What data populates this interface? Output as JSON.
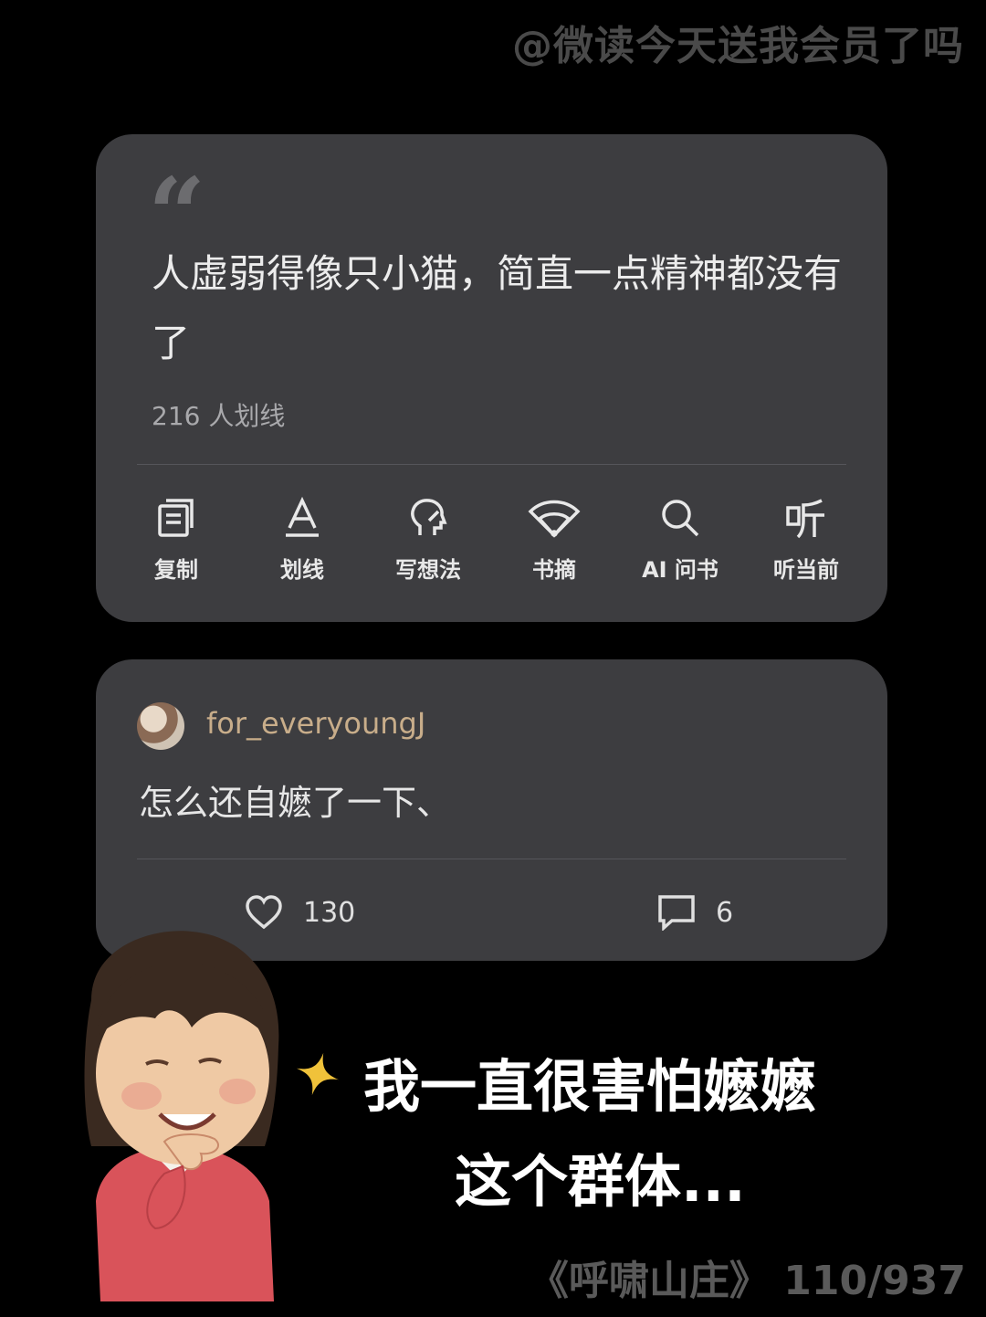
{
  "watermark": "@微读今天送我会员了吗",
  "quote": {
    "text": "人虚弱得像只小猫，简直一点精神都没有了",
    "highlight_count": "216 人划线"
  },
  "actions": [
    {
      "label": "复制",
      "icon": "copy-icon"
    },
    {
      "label": "划线",
      "icon": "underline-icon"
    },
    {
      "label": "写想法",
      "icon": "thought-icon"
    },
    {
      "label": "书摘",
      "icon": "fan-icon"
    },
    {
      "label": "AI 问书",
      "icon": "search-icon"
    },
    {
      "label": "听当前",
      "icon": "listen-icon"
    }
  ],
  "comment": {
    "username": "for_everyoungJ",
    "text": "怎么还自嬷了一下、",
    "likes": "130",
    "replies": "6"
  },
  "caption": {
    "line1": "我一直很害怕嬷嬷",
    "line2": "这个群体..."
  },
  "footer": "《呼啸山庄》 110/937"
}
